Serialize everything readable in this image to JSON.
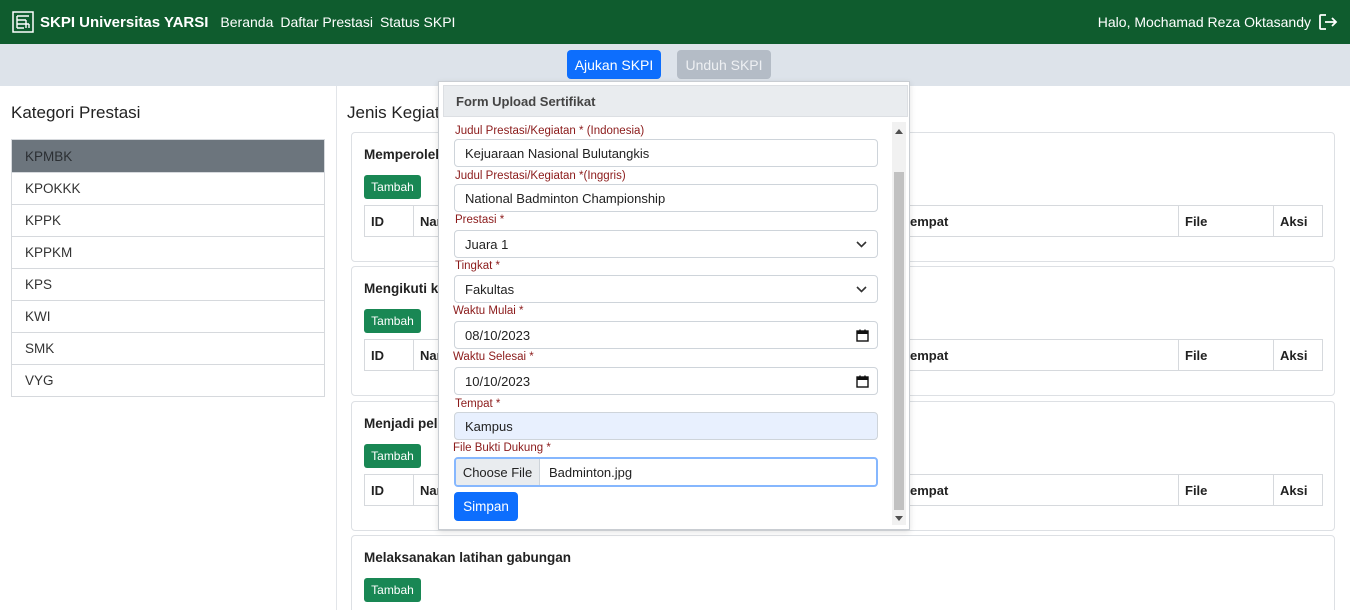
{
  "navbar": {
    "brand": "SKPI Universitas YARSI",
    "links": [
      "Beranda",
      "Daftar Prestasi",
      "Status SKPI"
    ],
    "greeting": "Halo, Mochamad Reza Oktasandy"
  },
  "actions": {
    "ajukan": "Ajukan SKPI",
    "unduh": "Unduh SKPI"
  },
  "sidebar": {
    "title": "Kategori Prestasi",
    "items": [
      "KPMBK",
      "KPOKKK",
      "KPPK",
      "KPPKM",
      "KPS",
      "KWI",
      "SMK",
      "VYG"
    ]
  },
  "main": {
    "title": "Jenis Kegiat",
    "tambah_label": "Tambah",
    "cards": [
      {
        "title": "Memperoleh"
      },
      {
        "title": "Mengikuti k"
      },
      {
        "title": "Menjadi pel"
      },
      {
        "title": "Melaksanakan latihan gabungan"
      }
    ],
    "table_headers": {
      "id": "ID",
      "nama": "Nar",
      "tempat": "empat",
      "file": "File",
      "aksi": "Aksi"
    }
  },
  "modal": {
    "title": "Form Upload Sertifikat",
    "fields": {
      "judul_id": {
        "label": "Judul Prestasi/Kegiatan * (Indonesia)",
        "value": "Kejuaraan Nasional Bulutangkis"
      },
      "judul_en": {
        "label": "Judul Prestasi/Kegiatan *(Inggris)",
        "value": "National Badminton Championship"
      },
      "prestasi": {
        "label": "Prestasi *",
        "value": "Juara 1"
      },
      "tingkat": {
        "label": "Tingkat *",
        "value": "Fakultas"
      },
      "waktu_mulai": {
        "label": "Waktu Mulai *",
        "value": "08/10/2023"
      },
      "waktu_selesai": {
        "label": "Waktu Selesai *",
        "value": "10/10/2023"
      },
      "tempat": {
        "label": "Tempat *",
        "value": "Kampus"
      },
      "file": {
        "label": "File Bukti Dukung *",
        "button": "Choose File",
        "value": "Badminton.jpg"
      }
    },
    "submit": "Simpan"
  },
  "colors": {
    "navbar": "#0f5c2e",
    "primary": "#0d6efd",
    "success": "#198754",
    "label": "#8b1a1a"
  }
}
